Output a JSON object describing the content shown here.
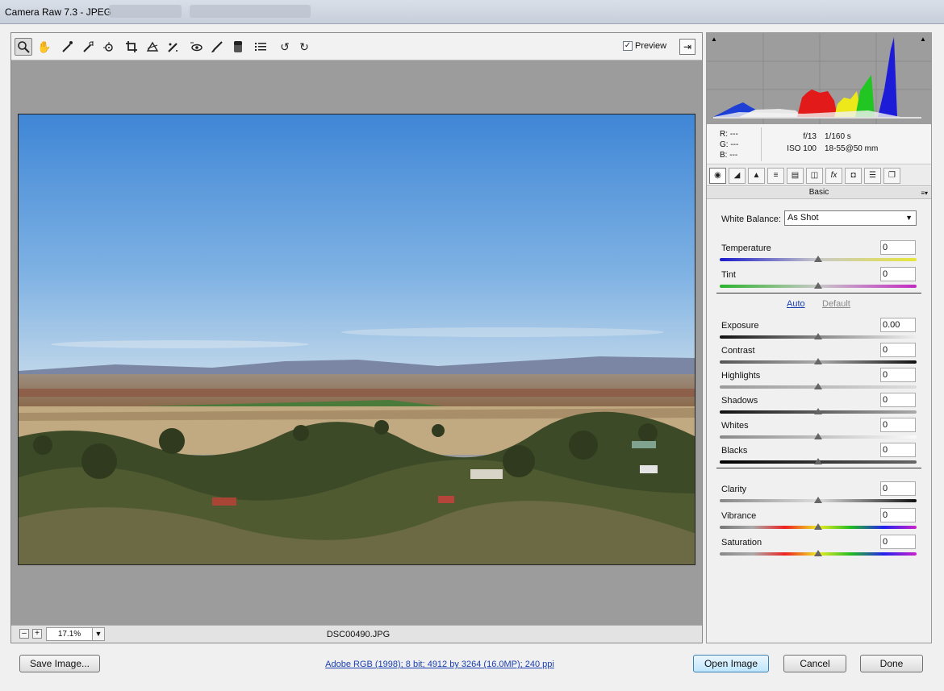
{
  "window": {
    "title": "Camera Raw 7.3  -  JPEG"
  },
  "toolbar": {
    "tools": [
      "zoom-tool",
      "hand-tool",
      "white-balance-tool",
      "color-sampler-tool",
      "targeted-adjustment-tool",
      "crop-tool",
      "straighten-tool",
      "spot-removal-tool",
      "red-eye-tool",
      "adjustment-brush-tool",
      "graduated-filter-tool",
      "preferences",
      "rotate-ccw",
      "rotate-cw"
    ],
    "preview_label": "Preview",
    "preview_checked": "✓"
  },
  "status": {
    "zoom_out": "–",
    "zoom_in": "+",
    "zoom": "17.1%",
    "filename": "DSC00490.JPG"
  },
  "info": {
    "r": "R:   ---",
    "g": "G:   ---",
    "b": "B:   ---",
    "aperture": "f/13",
    "shutter": "1/160 s",
    "iso": "ISO 100",
    "lens": "18-55@50 mm"
  },
  "panel": {
    "title": "Basic",
    "white_balance_label": "White Balance:",
    "white_balance_value": "As Shot",
    "auto": "Auto",
    "default": "Default",
    "sliders": [
      {
        "label": "Temperature",
        "value": "0"
      },
      {
        "label": "Tint",
        "value": "0"
      },
      {
        "label": "Exposure",
        "value": "0.00"
      },
      {
        "label": "Contrast",
        "value": "0"
      },
      {
        "label": "Highlights",
        "value": "0"
      },
      {
        "label": "Shadows",
        "value": "0"
      },
      {
        "label": "Whites",
        "value": "0"
      },
      {
        "label": "Blacks",
        "value": "0"
      },
      {
        "label": "Clarity",
        "value": "0"
      },
      {
        "label": "Vibrance",
        "value": "0"
      },
      {
        "label": "Saturation",
        "value": "0"
      }
    ]
  },
  "buttons": {
    "save": "Save Image...",
    "workflow": "Adobe RGB (1998); 8 bit; 4912 by 3264 (16.0MP); 240 ppi",
    "open": "Open Image",
    "cancel": "Cancel",
    "done": "Done"
  }
}
